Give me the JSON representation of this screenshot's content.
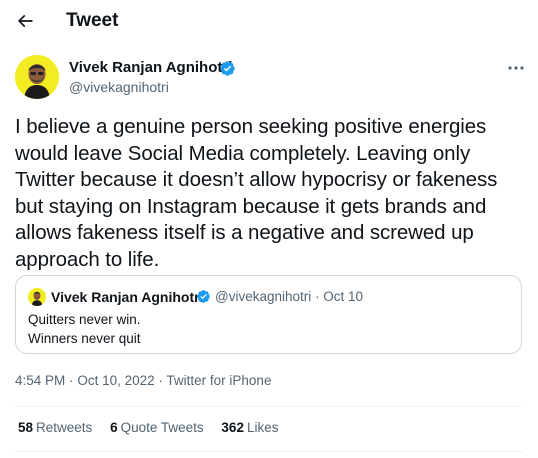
{
  "header": {
    "title": "Tweet",
    "back_icon": "arrow-left-icon"
  },
  "author": {
    "name": "Vivek Ranjan Agnihotri",
    "handle": "@vivekagnihotri",
    "verified_color": "#1d9bf0",
    "avatar_bg": "#f4ec23"
  },
  "tweet": {
    "text": "I believe a genuine person seeking positive energies would leave Social Media completely. Leaving only Twitter because it doesn’t allow hypocrisy or fakeness but staying on Instagram  because it gets brands and allows fakeness itself is a negative and screwed up approach to life."
  },
  "quote": {
    "name": "Vivek Ranjan Agnihotri",
    "handle": "@vivekagnihotri",
    "separator": "·",
    "date": "Oct 10",
    "lines": [
      "Quitters never win.",
      "Winners never quit"
    ]
  },
  "meta": {
    "time": "4:54 PM",
    "separator": "·",
    "date": "Oct 10, 2022",
    "source": "Twitter for iPhone"
  },
  "stats": {
    "retweets_count": "58",
    "retweets_label": "Retweets",
    "quotes_count": "6",
    "quotes_label": "Quote Tweets",
    "likes_count": "362",
    "likes_label": "Likes"
  },
  "colors": {
    "text": "#0f1419",
    "secondary": "#536471",
    "accent": "#1d9bf0",
    "border": "#cfd9de"
  }
}
